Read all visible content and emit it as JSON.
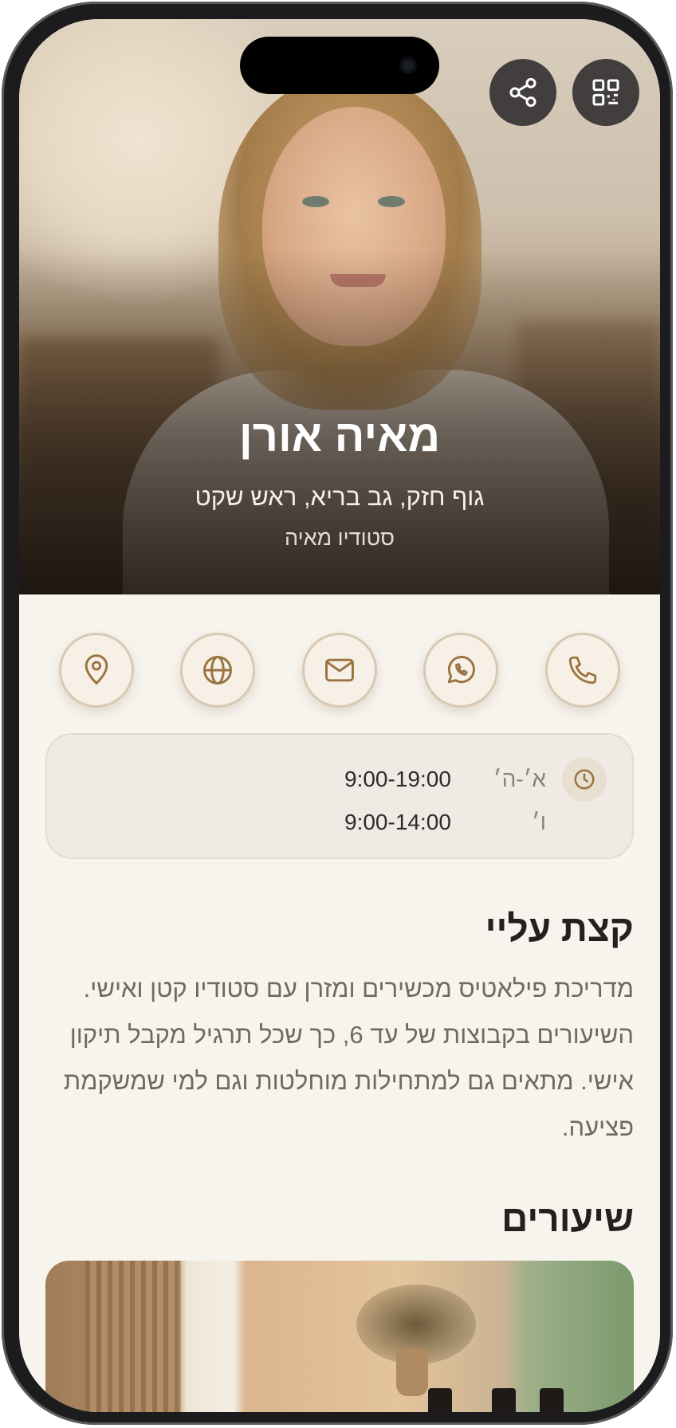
{
  "profile": {
    "name": "מאיה אורן",
    "tagline": "גוף חזק, גב בריא, ראש שקט",
    "studio": "סטודיו מאיה"
  },
  "hero_actions": {
    "share_icon": "share-icon",
    "qr_icon": "qr-code-icon"
  },
  "contact_actions": [
    {
      "icon": "phone-icon"
    },
    {
      "icon": "whatsapp-icon"
    },
    {
      "icon": "mail-icon"
    },
    {
      "icon": "globe-icon"
    },
    {
      "icon": "map-pin-icon"
    }
  ],
  "hours": {
    "icon": "clock-icon",
    "rows": [
      {
        "day": "א׳-ה׳",
        "time": "9:00-19:00"
      },
      {
        "day": "ו׳",
        "time": "9:00-14:00"
      }
    ]
  },
  "about": {
    "title": "קצת עליי",
    "text": "מדריכת פילאטיס מכשירים ומזרן עם סטודיו קטן ואישי. השיעורים בקבוצות של עד 6, כך שכל תרגיל מקבל תיקון אישי. מתאים גם למתחילות מוחלטות וגם למי שמשקמת פציעה."
  },
  "classes": {
    "title": "שיעורים"
  },
  "colors": {
    "accent": "#9a7440",
    "background": "#f7f4ee",
    "card": "#efebe4"
  }
}
